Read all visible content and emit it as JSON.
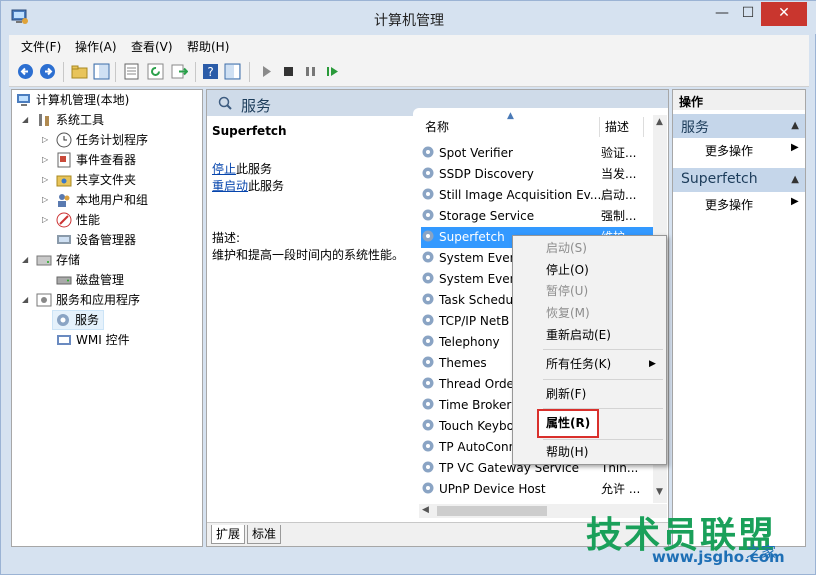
{
  "window": {
    "title": "计算机管理",
    "min_label": "—",
    "max_label": "☐",
    "close_label": "✕"
  },
  "menu": [
    "文件(F)",
    "操作(A)",
    "查看(V)",
    "帮助(H)"
  ],
  "tree": [
    {
      "label": "计算机管理(本地)",
      "icon": "computer-management-icon"
    },
    {
      "label": "系统工具",
      "icon": "tools-icon"
    },
    {
      "label": "任务计划程序",
      "icon": "clock-icon"
    },
    {
      "label": "事件查看器",
      "icon": "event-viewer-icon"
    },
    {
      "label": "共享文件夹",
      "icon": "shared-folder-icon"
    },
    {
      "label": "本地用户和组",
      "icon": "users-icon"
    },
    {
      "label": "性能",
      "icon": "performance-icon"
    },
    {
      "label": "设备管理器",
      "icon": "device-manager-icon"
    },
    {
      "label": "存储",
      "icon": "storage-icon"
    },
    {
      "label": "磁盘管理",
      "icon": "disk-icon"
    },
    {
      "label": "服务和应用程序",
      "icon": "services-apps-icon"
    },
    {
      "label": "服务",
      "icon": "services-gear-icon"
    },
    {
      "label": "WMI 控件",
      "icon": "wmi-icon"
    }
  ],
  "center": {
    "header": "服务",
    "detail": {
      "service_name": "Superfetch",
      "stop_link": "停止",
      "stop_suffix": "此服务",
      "restart_link": "重启动",
      "restart_suffix": "此服务",
      "desc_label": "描述:",
      "desc_text": "维护和提高一段时间内的系统性能。"
    },
    "columns": {
      "name": "名称",
      "desc": "描述"
    },
    "rows": [
      {
        "name": "Spot Verifier",
        "desc": "验证..."
      },
      {
        "name": "SSDP Discovery",
        "desc": "当发..."
      },
      {
        "name": "Still Image Acquisition Ev...",
        "desc": "启动..."
      },
      {
        "name": "Storage Service",
        "desc": "强制..."
      },
      {
        "name": "Superfetch",
        "desc": "维护..."
      },
      {
        "name": "System Even",
        "desc": ""
      },
      {
        "name": "System Even",
        "desc": ""
      },
      {
        "name": "Task Schedu",
        "desc": ""
      },
      {
        "name": "TCP/IP NetB",
        "desc": ""
      },
      {
        "name": "Telephony",
        "desc": ""
      },
      {
        "name": "Themes",
        "desc": ""
      },
      {
        "name": "Thread Orde",
        "desc": ""
      },
      {
        "name": "Time Broker",
        "desc": ""
      },
      {
        "name": "Touch Keybo",
        "desc": ""
      },
      {
        "name": "TP AutoConn",
        "desc": ""
      },
      {
        "name": "TP VC Gateway Service",
        "desc": "Thin..."
      },
      {
        "name": "UPnP Device Host",
        "desc": "允许 ..."
      }
    ],
    "tabs": [
      "扩展",
      "标准"
    ]
  },
  "actions": {
    "header": "操作",
    "section1": "服务",
    "more1": "更多操作",
    "section2": "Superfetch",
    "more2": "更多操作"
  },
  "context_menu": {
    "start": "启动(S)",
    "stop": "停止(O)",
    "pause": "暂停(U)",
    "resume": "恢复(M)",
    "restart": "重新启动(E)",
    "all_tasks": "所有任务(K)",
    "refresh": "刷新(F)",
    "properties": "属性(R)",
    "help": "帮助(H)"
  },
  "watermark": {
    "brand": "技术员联盟",
    "url": "www.jsgho.com",
    "sub": "之家"
  },
  "colors": {
    "selection": "#3399ff",
    "highlight_box": "#d9302c",
    "panel_header": "#c5d6ea",
    "link": "#0645ad"
  }
}
